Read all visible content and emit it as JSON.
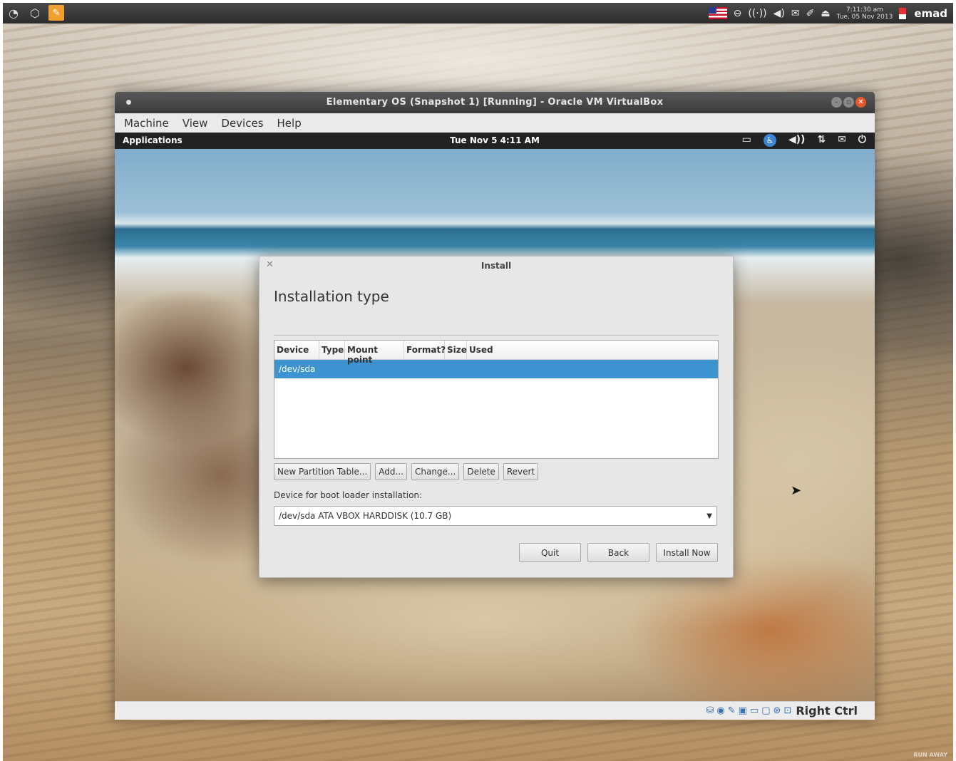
{
  "host_panel": {
    "time": "7:11:30 am",
    "date": "Tue, 05 Nov 2013",
    "username": "emad"
  },
  "vbox": {
    "title": "Elementary OS (Snapshot 1) [Running] - Oracle VM VirtualBox",
    "menu": [
      "Machine",
      "View",
      "Devices",
      "Help"
    ],
    "host_key": "Right Ctrl"
  },
  "guest_panel": {
    "applications": "Applications",
    "clock": "Tue Nov  5  4:11 AM"
  },
  "dialog": {
    "title": "Install",
    "heading": "Installation type",
    "columns": [
      "Device",
      "Type",
      "Mount point",
      "Format?",
      "Size",
      "Used"
    ],
    "rows": [
      "/dev/sda"
    ],
    "partition_buttons": [
      "New Partition Table...",
      "Add...",
      "Change...",
      "Delete",
      "Revert"
    ],
    "boot_loader_label": "Device for boot loader installation:",
    "boot_loader_value": "/dev/sda  ATA VBOX HARDDISK (10.7 GB)",
    "actions": [
      "Quit",
      "Back",
      "Install Now"
    ]
  },
  "colors": {
    "selection": "#3c93cf",
    "close_button": "#e5582d"
  }
}
